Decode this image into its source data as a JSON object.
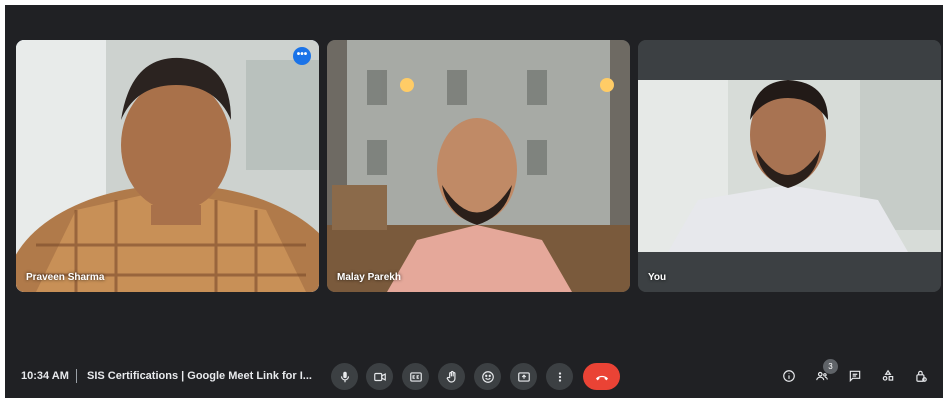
{
  "participants": [
    {
      "name": "Praveen Sharma",
      "active_speaker": true
    },
    {
      "name": "Malay Parekh",
      "active_speaker": false
    },
    {
      "name": "You",
      "active_speaker": false
    }
  ],
  "tile_menu": {
    "icon": "more-horiz-icon",
    "label": "•••"
  },
  "bottom_bar": {
    "time": "10:34 AM",
    "meeting_title": "SIS Certifications | Google Meet Link for I...",
    "controls": [
      "mic-icon",
      "camera-icon",
      "captions-icon",
      "raise-hand-icon",
      "emoji-icon",
      "present-icon",
      "more-vert-icon",
      "end-call-icon"
    ],
    "side_icons": [
      "info-icon",
      "people-icon",
      "chat-icon",
      "activities-icon",
      "host-controls-icon"
    ],
    "people_count": "3"
  },
  "colors": {
    "background": "#202124",
    "control": "#3c4043",
    "end_call": "#ea4335",
    "active_border": "#8ab4f8",
    "badge": "#1a73e8"
  }
}
